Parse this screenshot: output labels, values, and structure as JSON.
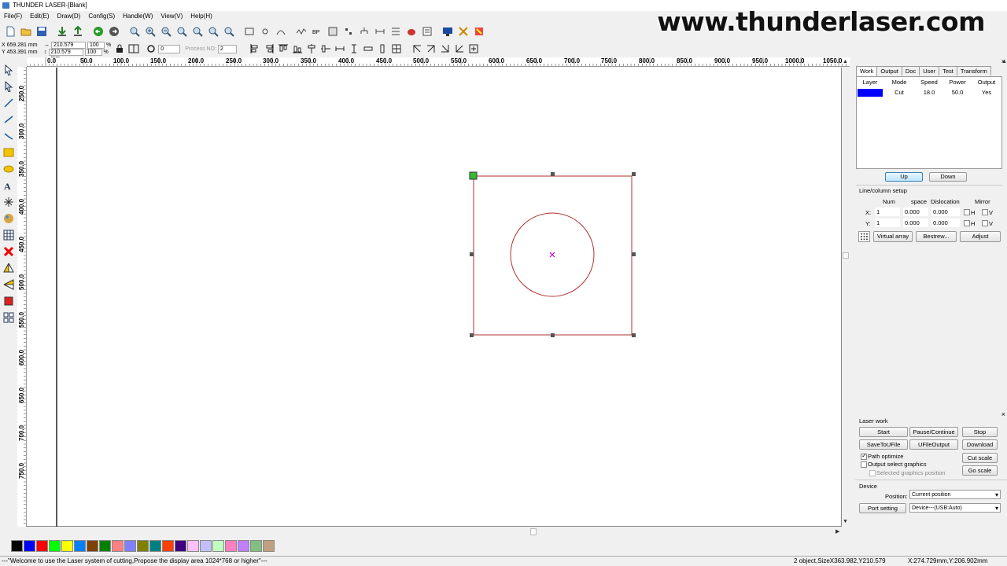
{
  "window": {
    "title": "THUNDER LASER-[Blank]",
    "watermark": "www.thunderlaser.com"
  },
  "menu": [
    "File(F)",
    "Edit(E)",
    "Draw(D)",
    "Config(S)",
    "Handle(W)",
    "View(V)",
    "Help(H)"
  ],
  "coords": {
    "x": "659.281 mm",
    "y": "453.391 mm",
    "width": "210.579 mm",
    "height": "210.579 mm",
    "scale_w": "100",
    "scale_h": "100",
    "unit": "%",
    "rotation": "0",
    "process_no_label": "Process NO:",
    "process_no": "2"
  },
  "ruler": {
    "top": [
      "0.0",
      "50.0",
      "100.0",
      "150.0",
      "200.0",
      "250.0",
      "300.0",
      "350.0",
      "400.0",
      "450.0",
      "500.0",
      "550.0",
      "600.0",
      "650.0",
      "700.0",
      "750.0",
      "800.0",
      "850.0",
      "900.0",
      "950.0",
      "1000.0",
      "1050.0"
    ],
    "left": [
      "250.0",
      "300.0",
      "350.0",
      "400.0",
      "450.0",
      "500.0",
      "550.0",
      "600.0",
      "650.0",
      "700.0",
      "750.0"
    ]
  },
  "work_panel": {
    "tabs": [
      "Work",
      "Output",
      "Doc",
      "User",
      "Test",
      "Transform"
    ],
    "columns": [
      "Layer",
      "Mode",
      "Speed",
      "Power",
      "Output"
    ],
    "rows": [
      {
        "color": "#0000ff",
        "mode": "Cut",
        "speed": "18.0",
        "power": "50.0",
        "output": "Yes"
      }
    ],
    "up": "Up",
    "down": "Down",
    "line_column_setup": "Line/column setup",
    "grid_headers": [
      "Num",
      "space",
      "Dislocation",
      "Mirror"
    ],
    "x_label": "X:",
    "y_label": "Y:",
    "x_num": "1",
    "x_space": "0.000",
    "x_dislocation": "0.000",
    "y_num": "1",
    "y_space": "0.000",
    "y_dislocation": "0.000",
    "mirror_h": "H",
    "mirror_v": "V",
    "virtual_array": "Virtual array",
    "bestrew": "Bestrew...",
    "adjust": "Adjust"
  },
  "laser_work": {
    "title": "Laser work",
    "start": "Start",
    "pause": "Pause/Continue",
    "stop": "Stop",
    "save_to_u": "SaveToUFile",
    "ufile_output": "UFileOutput",
    "download": "Download",
    "path_optimize": "Path optimize",
    "output_select": "Output select graphics",
    "selected_position": "Selected graphics position",
    "cut_scale": "Cut scale",
    "go_scale": "Go scale",
    "device_title": "Device",
    "position_label": "Position:",
    "position_value": "Current position",
    "port_setting": "Port setting",
    "device_value": "Device---(USB:Auto)"
  },
  "palette": [
    "#000000",
    "#0000ff",
    "#ff0000",
    "#00ff00",
    "#ffff00",
    "#0080ff",
    "#804000",
    "#008000",
    "#ff8080",
    "#8080ff",
    "#808000",
    "#008080",
    "#ff4000",
    "#400080",
    "#ffc0ff",
    "#c0c0ff",
    "#c0ffc0",
    "#ff80c0",
    "#c080ff",
    "#80c080",
    "#c0a080"
  ],
  "status": {
    "message": "---\"Welcome to use the Laser system of cutting,Propose the display area 1024*768 or higher\"---",
    "selection": "2 object,SizeX363.982,Y210.579",
    "cursor": "X:274.729mm,Y:206.902mm"
  }
}
